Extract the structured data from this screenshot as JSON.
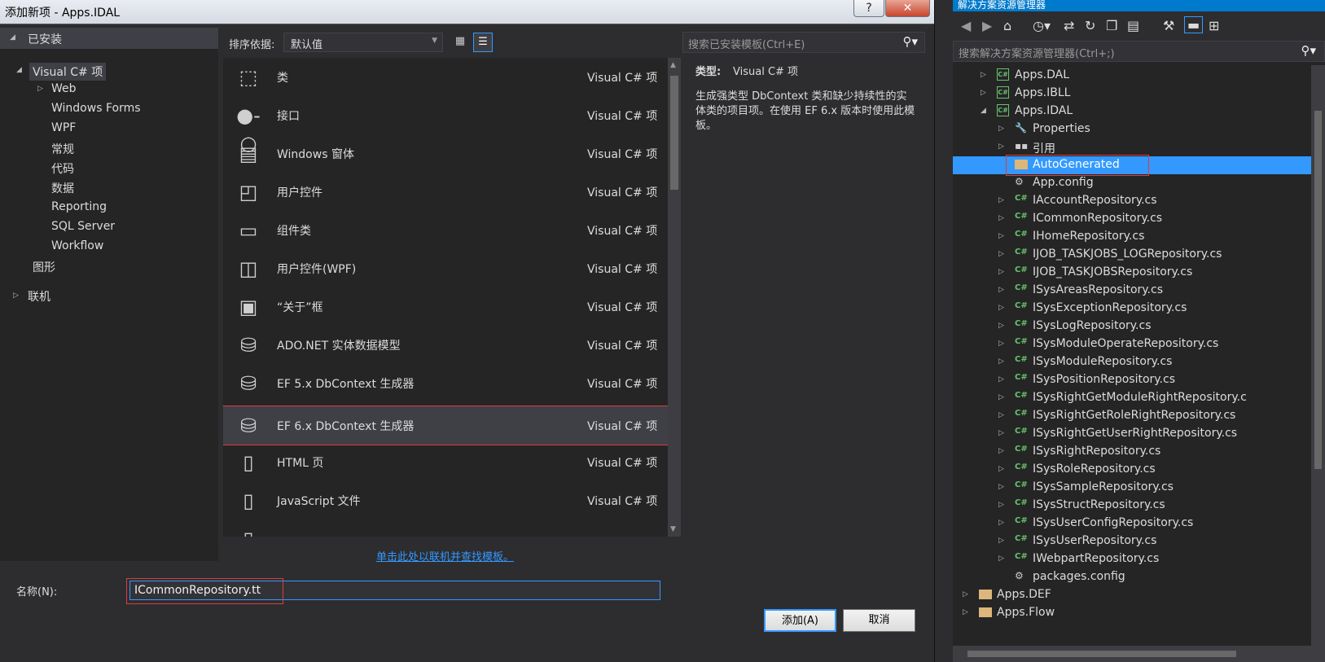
{
  "dialog": {
    "title": "添加新项 - Apps.IDAL",
    "help_label": "?",
    "close_label": "✕"
  },
  "left_tree": {
    "installed": "已安装",
    "csharp": "Visual C# 项",
    "items": [
      "Web",
      "Windows Forms",
      "WPF",
      "常规",
      "代码",
      "数据",
      "Reporting",
      "SQL Server",
      "Workflow"
    ],
    "graphics": "图形",
    "online": "联机"
  },
  "toolbar": {
    "sort_label": "排序依据:",
    "sort_value": "默认值",
    "search_placeholder": "搜索已安装模板(Ctrl+E)"
  },
  "templates": [
    {
      "name": "类",
      "type": "Visual C# 项",
      "icon": "class-icon"
    },
    {
      "name": "接口",
      "type": "Visual C# 项",
      "icon": "interface-icon"
    },
    {
      "name": "Windows 窗体",
      "type": "Visual C# 项",
      "icon": "form-icon"
    },
    {
      "name": "用户控件",
      "type": "Visual C# 项",
      "icon": "user-control-icon"
    },
    {
      "name": "组件类",
      "type": "Visual C# 项",
      "icon": "component-icon"
    },
    {
      "name": "用户控件(WPF)",
      "type": "Visual C# 项",
      "icon": "wpf-control-icon"
    },
    {
      "name": "“关于”框",
      "type": "Visual C# 项",
      "icon": "about-box-icon"
    },
    {
      "name": "ADO.NET 实体数据模型",
      "type": "Visual C# 项",
      "icon": "entity-model-icon"
    },
    {
      "name": "EF 5.x DbContext 生成器",
      "type": "Visual C# 项",
      "icon": "ef5-generator-icon"
    },
    {
      "name": "EF 6.x DbContext 生成器",
      "type": "Visual C# 项",
      "icon": "ef6-generator-icon",
      "selected": true
    },
    {
      "name": "HTML 页",
      "type": "Visual C# 项",
      "icon": "html-page-icon"
    },
    {
      "name": "JavaScript 文件",
      "type": "Visual C# 项",
      "icon": "js-file-icon"
    },
    {
      "name": "",
      "type": "",
      "icon": "partial-item-icon"
    }
  ],
  "description": {
    "type_label": "类型:",
    "type_value": "Visual C# 项",
    "body": "生成强类型 DbContext 类和缺少持续性的实体类的项目项。在使用 EF 6.x 版本时使用此模板。"
  },
  "online_link": "单击此处以联机并查找模板。",
  "name_field": {
    "label": "名称(N):",
    "value": "ICommonRepository.tt"
  },
  "buttons": {
    "add": "添加(A)",
    "cancel": "取消"
  },
  "solution_explorer": {
    "title": "解决方案资源管理器",
    "search_placeholder": "搜索解决方案资源管理器(Ctrl+;)",
    "nodes": [
      {
        "label": "Apps.DAL",
        "level": 1,
        "kind": "project",
        "exp": "right"
      },
      {
        "label": "Apps.IBLL",
        "level": 1,
        "kind": "project",
        "exp": "right"
      },
      {
        "label": "Apps.IDAL",
        "level": 1,
        "kind": "project",
        "exp": "down"
      },
      {
        "label": "Properties",
        "level": 2,
        "kind": "properties",
        "exp": "right"
      },
      {
        "label": "引用",
        "level": 2,
        "kind": "references",
        "exp": "right"
      },
      {
        "label": "AutoGenerated",
        "level": 2,
        "kind": "folder",
        "exp": "",
        "selected": true
      },
      {
        "label": "App.config",
        "level": 2,
        "kind": "config",
        "exp": ""
      },
      {
        "label": "IAccountRepository.cs",
        "level": 2,
        "kind": "cs",
        "exp": "right"
      },
      {
        "label": "ICommonRepository.cs",
        "level": 2,
        "kind": "cs",
        "exp": "right"
      },
      {
        "label": "IHomeRepository.cs",
        "level": 2,
        "kind": "cs",
        "exp": "right"
      },
      {
        "label": "IJOB_TASKJOBS_LOGRepository.cs",
        "level": 2,
        "kind": "cs",
        "exp": "right"
      },
      {
        "label": "IJOB_TASKJOBSRepository.cs",
        "level": 2,
        "kind": "cs",
        "exp": "right"
      },
      {
        "label": "ISysAreasRepository.cs",
        "level": 2,
        "kind": "cs",
        "exp": "right"
      },
      {
        "label": "ISysExceptionRepository.cs",
        "level": 2,
        "kind": "cs",
        "exp": "right"
      },
      {
        "label": "ISysLogRepository.cs",
        "level": 2,
        "kind": "cs",
        "exp": "right"
      },
      {
        "label": "ISysModuleOperateRepository.cs",
        "level": 2,
        "kind": "cs",
        "exp": "right"
      },
      {
        "label": "ISysModuleRepository.cs",
        "level": 2,
        "kind": "cs",
        "exp": "right"
      },
      {
        "label": "ISysPositionRepository.cs",
        "level": 2,
        "kind": "cs",
        "exp": "right"
      },
      {
        "label": "ISysRightGetModuleRightRepository.c",
        "level": 2,
        "kind": "cs",
        "exp": "right"
      },
      {
        "label": "ISysRightGetRoleRightRepository.cs",
        "level": 2,
        "kind": "cs",
        "exp": "right"
      },
      {
        "label": "ISysRightGetUserRightRepository.cs",
        "level": 2,
        "kind": "cs",
        "exp": "right"
      },
      {
        "label": "ISysRightRepository.cs",
        "level": 2,
        "kind": "cs",
        "exp": "right"
      },
      {
        "label": "ISysRoleRepository.cs",
        "level": 2,
        "kind": "cs",
        "exp": "right"
      },
      {
        "label": "ISysSampleRepository.cs",
        "level": 2,
        "kind": "cs",
        "exp": "right"
      },
      {
        "label": "ISysStructRepository.cs",
        "level": 2,
        "kind": "cs",
        "exp": "right"
      },
      {
        "label": "ISysUserConfigRepository.cs",
        "level": 2,
        "kind": "cs",
        "exp": "right"
      },
      {
        "label": "ISysUserRepository.cs",
        "level": 2,
        "kind": "cs",
        "exp": "right"
      },
      {
        "label": "IWebpartRepository.cs",
        "level": 2,
        "kind": "cs",
        "exp": "right"
      },
      {
        "label": "packages.config",
        "level": 2,
        "kind": "config",
        "exp": ""
      },
      {
        "label": "Apps.DEF",
        "level": 0,
        "kind": "folder",
        "exp": "right"
      },
      {
        "label": "Apps.Flow",
        "level": 0,
        "kind": "folder",
        "exp": "right"
      }
    ]
  }
}
